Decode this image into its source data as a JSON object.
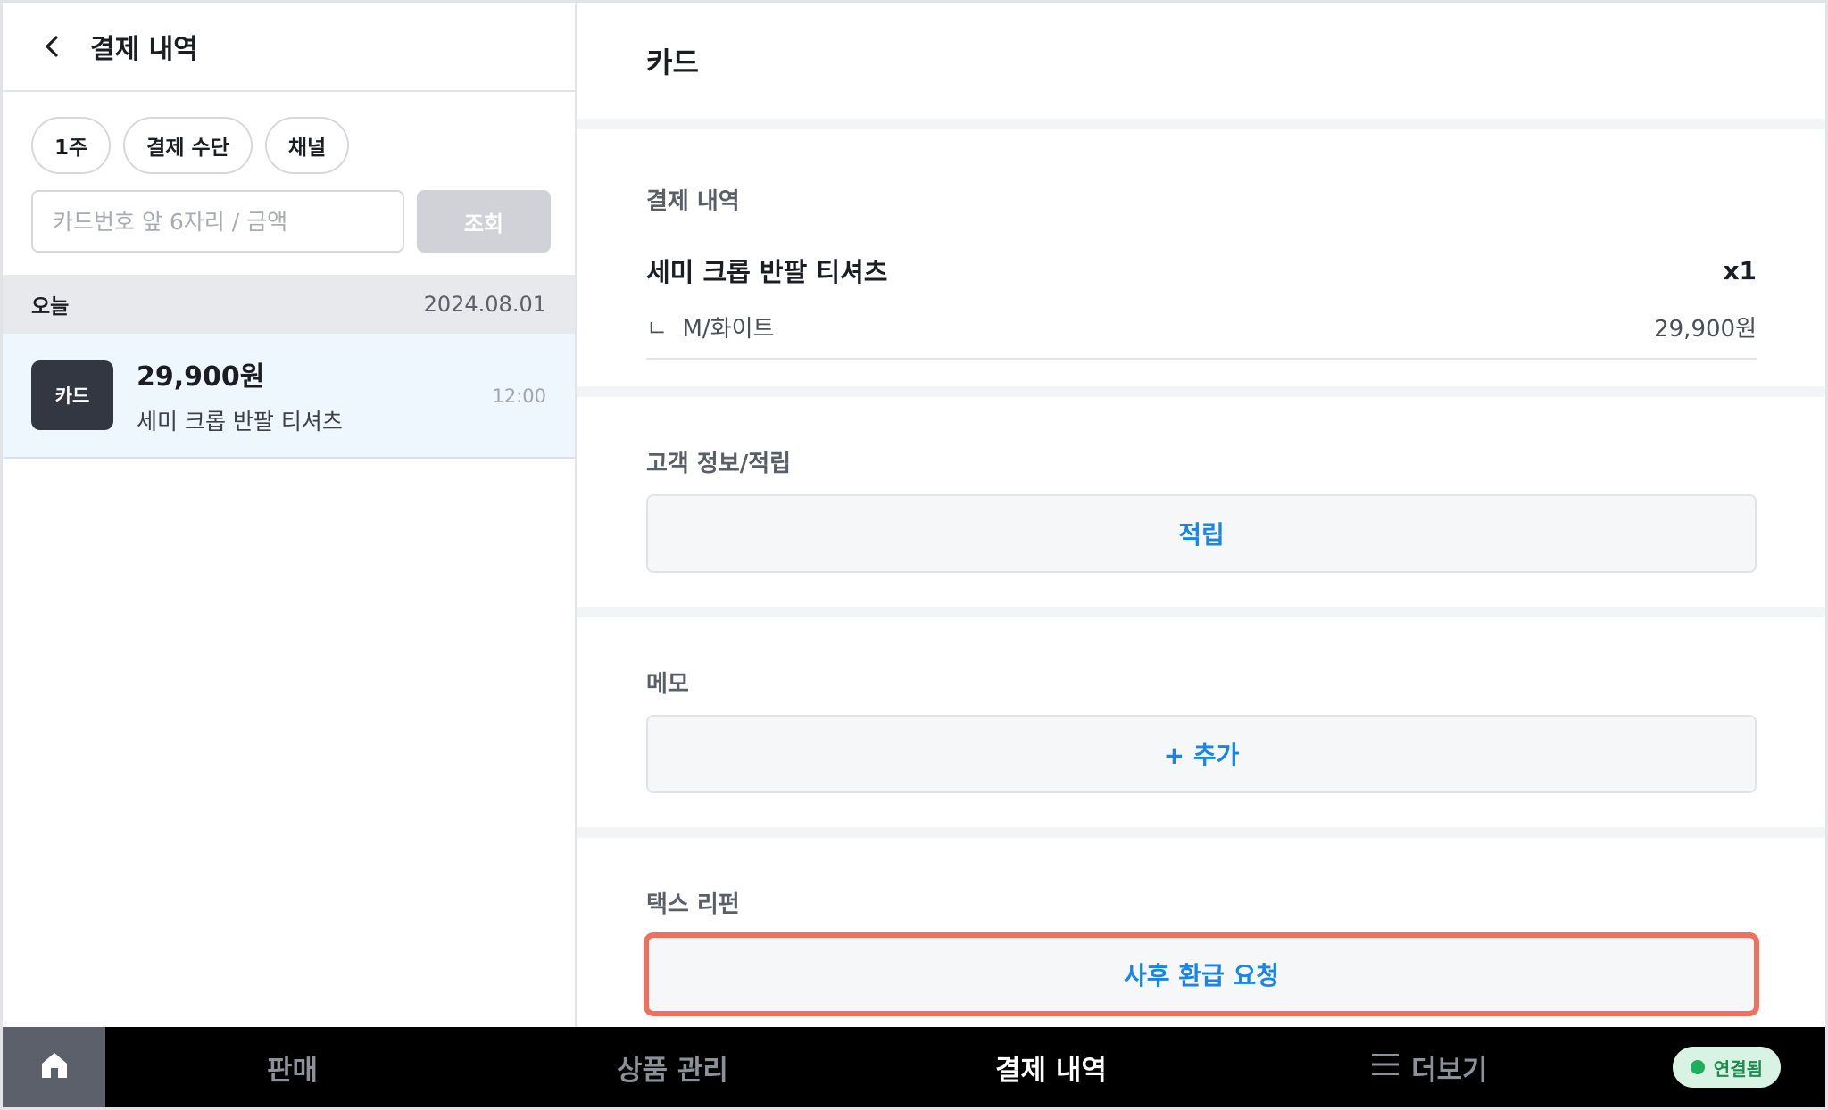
{
  "left": {
    "title": "결제 내역",
    "filters": [
      "1주",
      "결제 수단",
      "채널"
    ],
    "search": {
      "placeholder": "카드번호 앞 6자리 / 금액",
      "button": "조회"
    },
    "group": {
      "label": "오늘",
      "date": "2024.08.01"
    },
    "transaction": {
      "method": "카드",
      "amount": "29,900원",
      "item": "세미 크롭 반팔 티셔츠",
      "time": "12:00"
    }
  },
  "right": {
    "title": "카드",
    "payment": {
      "label": "결제 내역",
      "item_name": "세미 크롭 반팔 티셔츠",
      "quantity": "x1",
      "option_prefix": "ㄴ",
      "option": "M/화이트",
      "price": "29,900원"
    },
    "customer": {
      "label": "고객 정보/적립",
      "action": "적립"
    },
    "memo": {
      "label": "메모",
      "action": "+ 추가"
    },
    "tax_refund": {
      "label": "택스 리펀",
      "action": "사후 환급 요청"
    }
  },
  "nav": {
    "items": [
      "판매",
      "상품 관리",
      "결제 내역",
      "더보기"
    ],
    "active": "결제 내역",
    "status": "연결됨"
  },
  "colors": {
    "accent_blue": "#1a85e5",
    "highlight_border": "#f07060",
    "status_green": "#1fae5c",
    "badge_dark": "#323742"
  }
}
